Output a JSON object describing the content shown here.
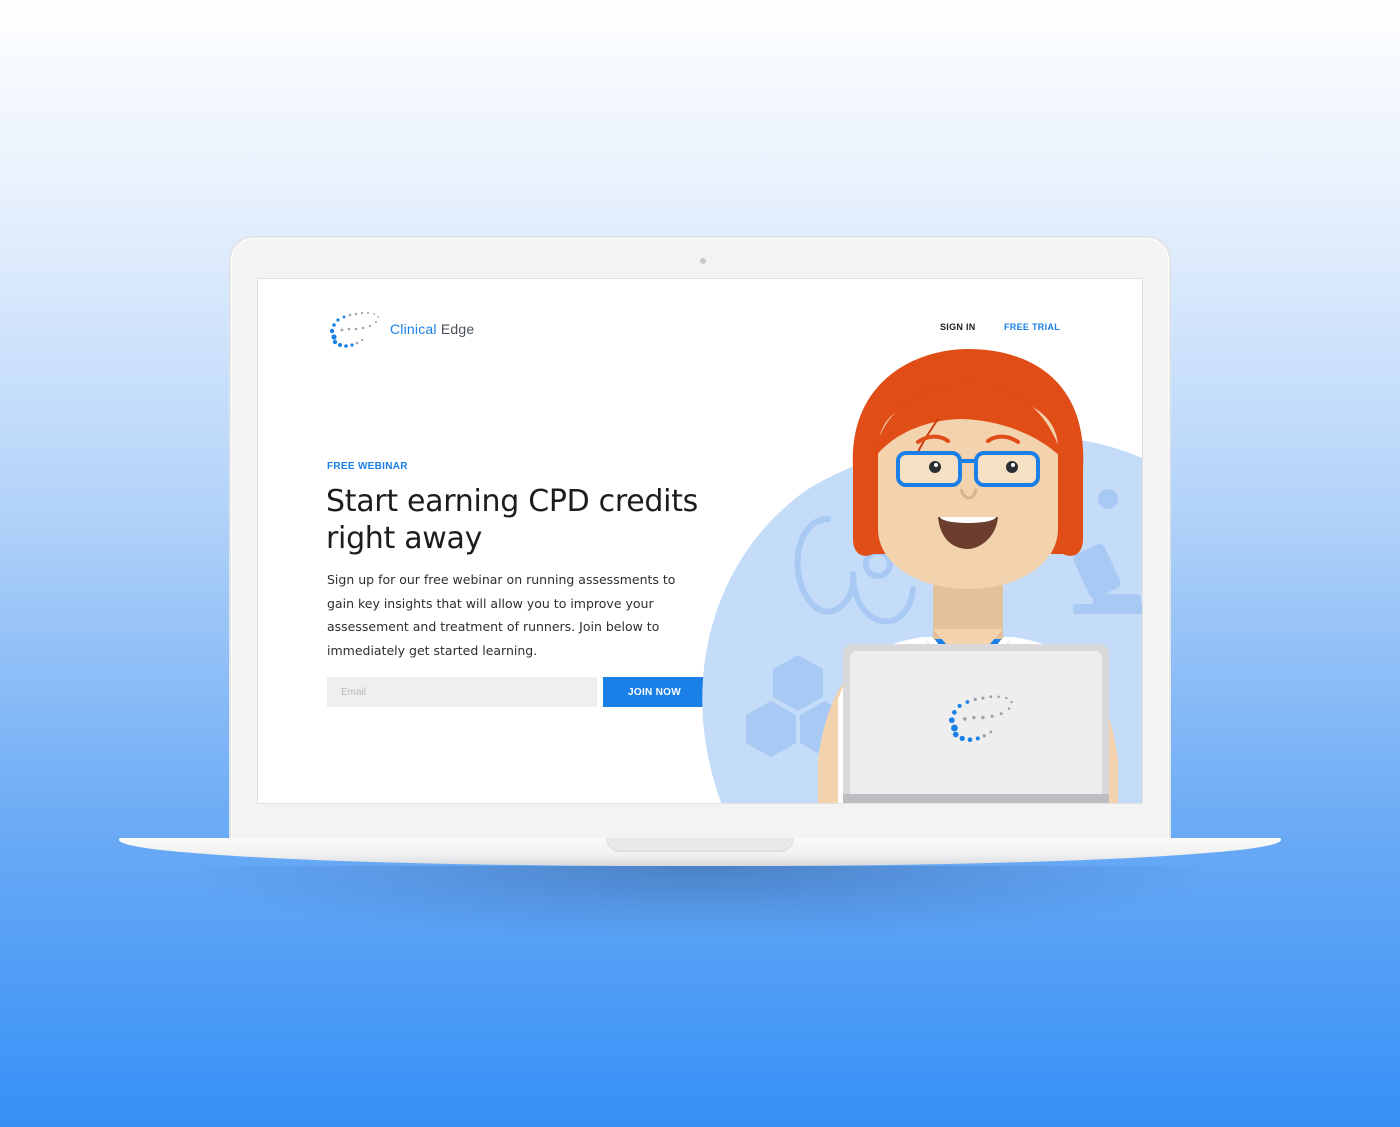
{
  "brand": {
    "name_part1": "Clinical",
    "name_part2": "Edge",
    "primary_color": "#1a7fe6"
  },
  "nav": {
    "sign_in": "SIGN IN",
    "free_trial": "FREE TRIAL"
  },
  "hero": {
    "eyebrow": "FREE WEBINAR",
    "headline": "Start earning CPD credits right away",
    "body": "Sign up for our free webinar on running assessments to gain key insights that will allow you to improve your assessement and treatment of runners. Join below to immediately get started learning."
  },
  "form": {
    "email_placeholder": "Email",
    "email_value": "",
    "submit_label": "JOIN NOW"
  },
  "illustration": {
    "subject": "doctor-with-laptop",
    "accent_color": "#c4dcf8",
    "hair_color": "#e14d17",
    "glasses_color": "#1a7fe6"
  }
}
